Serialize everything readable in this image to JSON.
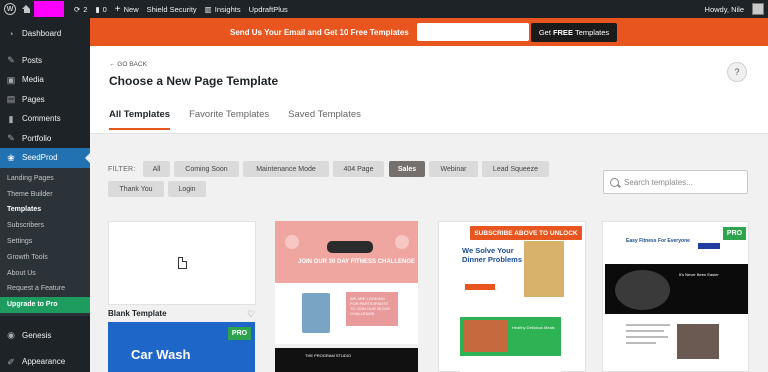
{
  "admin_bar": {
    "comments_count": "2",
    "pending_count": "0",
    "new_label": "New",
    "shield_label": "Shield Security",
    "insights_label": "Insights",
    "updraft_label": "UpdraftPlus",
    "howdy": "Howdy, Nile",
    "site_name_color": "#ff00ff"
  },
  "sidebar": {
    "items": [
      {
        "label": "Dashboard",
        "icon": "dashboard-icon"
      },
      {
        "label": "Posts",
        "icon": "pin-icon"
      },
      {
        "label": "Media",
        "icon": "media-icon"
      },
      {
        "label": "Pages",
        "icon": "pages-icon"
      },
      {
        "label": "Comments",
        "icon": "comment-icon"
      },
      {
        "label": "Portfolio",
        "icon": "pin-icon"
      },
      {
        "label": "SeedProd",
        "icon": "seedprod-icon"
      }
    ],
    "submenu": [
      "Landing Pages",
      "Theme Builder",
      "Templates",
      "Subscribers",
      "Settings",
      "Growth Tools",
      "About Us",
      "Request a Feature",
      "Upgrade to Pro"
    ],
    "bottom_items": [
      {
        "label": "Genesis",
        "icon": "genesis-icon"
      },
      {
        "label": "Appearance",
        "icon": "brush-icon"
      }
    ]
  },
  "banner": {
    "text": "Send Us Your Email and Get 10 Free Templates",
    "input_value": "",
    "button_prefix": "Get",
    "button_bold": "FREE",
    "button_suffix": "Templates",
    "color": "#e8551f"
  },
  "header": {
    "go_back": "← GO BACK",
    "title": "Choose a New Page Template",
    "help_icon": "?",
    "tabs": [
      "All Templates",
      "Favorite Templates",
      "Saved Templates"
    ]
  },
  "filters": {
    "label": "FILTER:",
    "chips": [
      "All",
      "Coming Soon",
      "Maintenance Mode",
      "404 Page",
      "Sales",
      "Webinar",
      "Lead Squeeze",
      "Thank You",
      "Login"
    ],
    "active": "Sales"
  },
  "search": {
    "placeholder": "Search templates..."
  },
  "cards": {
    "blank_label": "Blank Template",
    "pro_badge": "PRO",
    "carwash_text": "Car Wash",
    "fitness_text": "JOIN OUR 30 DAY FITNESS CHALLENGE",
    "fitness_box_text": "WE ARE LOOKING FOR PARTICIPANTS TO JOIN OUR 30 DAY CHALLENGE",
    "fitness_bottom_text": "THE PROGRAM STUDIO",
    "unlock_label": "SUBSCRIBE ABOVE TO UNLOCK",
    "dinner_heading": "We Solve Your Dinner Problems",
    "dinner_green_text": "Healthy Delicious Meals",
    "fitness2_heading": "Easy Fitness For Everyone",
    "fitness2_dark_text": "It's Never Been Easier",
    "fitness2_section": "Perfect for Everyone from Beginners to Pros"
  }
}
